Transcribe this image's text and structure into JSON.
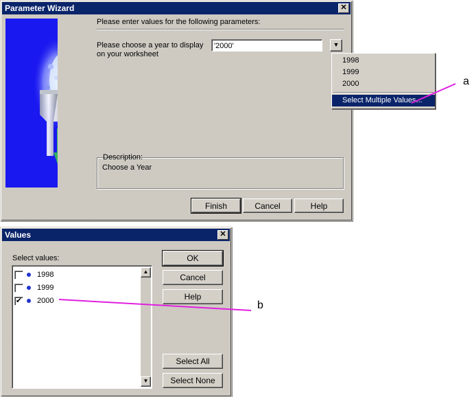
{
  "wizard": {
    "title": "Parameter Wizard",
    "instruction": "Please enter values for the following parameters:",
    "param_label_line1": "Please choose a year to display",
    "param_label_line2": "on your worksheet",
    "param_value": "'2000'",
    "dropdown_options": [
      "1998",
      "1999",
      "2000"
    ],
    "multi_option": "Select Multiple Values...",
    "description_legend": "Description:",
    "description_text": "Choose a Year",
    "finish_label": "Finish",
    "cancel_label": "Cancel",
    "help_label": "Help"
  },
  "values_dialog": {
    "title": "Values",
    "select_label": "Select values:",
    "items": [
      {
        "label": "1998",
        "checked": false
      },
      {
        "label": "1999",
        "checked": false
      },
      {
        "label": "2000",
        "checked": true
      }
    ],
    "ok_label": "OK",
    "cancel_label": "Cancel",
    "help_label": "Help",
    "select_all_label": "Select All",
    "select_none_label": "Select None"
  },
  "callouts": {
    "a": "a",
    "b": "b"
  },
  "colors": {
    "titlebar": "#0a246a",
    "callout_line": "#e020e0",
    "side_panel": "#1a18f0",
    "menu_highlight": "#0a246a"
  }
}
